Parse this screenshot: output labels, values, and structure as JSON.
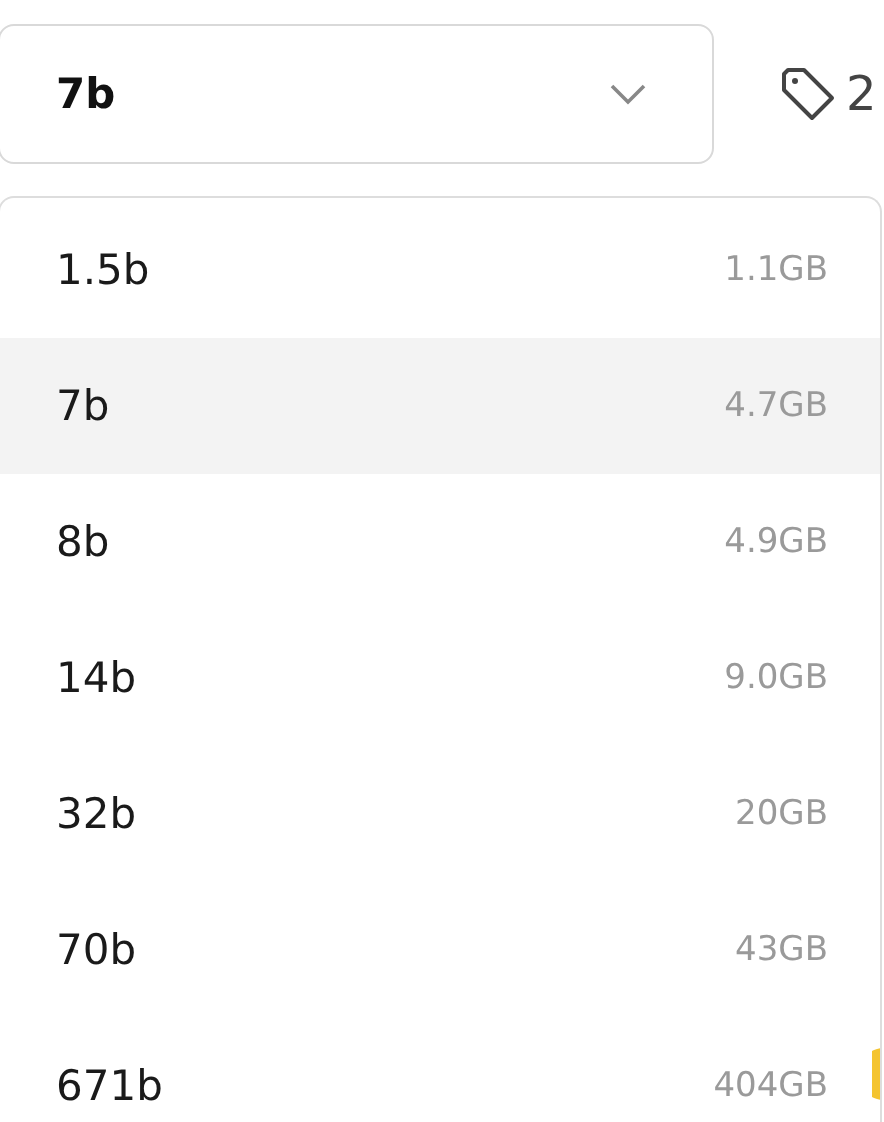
{
  "select": {
    "value": "7b"
  },
  "tag_count": "2",
  "options": [
    {
      "label": "1.5b",
      "size": "1.1GB",
      "selected": false
    },
    {
      "label": "7b",
      "size": "4.7GB",
      "selected": true
    },
    {
      "label": "8b",
      "size": "4.9GB",
      "selected": false
    },
    {
      "label": "14b",
      "size": "9.0GB",
      "selected": false
    },
    {
      "label": "32b",
      "size": "20GB",
      "selected": false
    },
    {
      "label": "70b",
      "size": "43GB",
      "selected": false
    },
    {
      "label": "671b",
      "size": "404GB",
      "selected": false
    }
  ]
}
